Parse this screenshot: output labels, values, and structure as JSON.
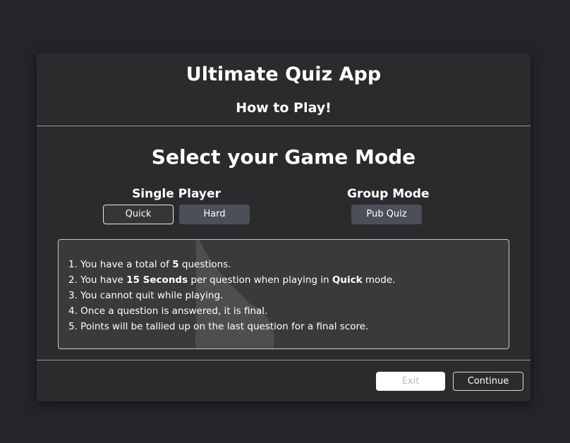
{
  "header": {
    "app_title": "Ultimate Quiz App",
    "how_to_play": "How to Play!"
  },
  "main": {
    "select_title": "Select your Game Mode",
    "single_player": {
      "label": "Single Player",
      "quick_label": "Quick",
      "hard_label": "Hard"
    },
    "group_mode": {
      "label": "Group Mode",
      "pub_quiz_label": "Pub Quiz"
    }
  },
  "rules": [
    {
      "n": "1.",
      "a": " You have a total of ",
      "b": "5",
      "c": " questions.",
      "d": "",
      "e": ""
    },
    {
      "n": "2.",
      "a": " You have ",
      "b": "15 Seconds",
      "c": " per question when playing in ",
      "d": "Quick",
      "e": " mode."
    },
    {
      "n": "3.",
      "a": " You cannot quit while playing.",
      "b": "",
      "c": "",
      "d": "",
      "e": ""
    },
    {
      "n": "4.",
      "a": " Once a question is answered, it is final.",
      "b": "",
      "c": "",
      "d": "",
      "e": ""
    },
    {
      "n": "5.",
      "a": " Points will be tallied up on the last question for a final score.",
      "b": "",
      "c": "",
      "d": "",
      "e": ""
    }
  ],
  "footer": {
    "exit_label": "Exit",
    "continue_label": "Continue"
  },
  "colors": {
    "background": "#232529",
    "modal": "#2b2b2d",
    "rules_box": "#3a3a3b",
    "secondary_button": "#4a4f58"
  },
  "icons": {
    "watermark": "droplet-icon"
  }
}
